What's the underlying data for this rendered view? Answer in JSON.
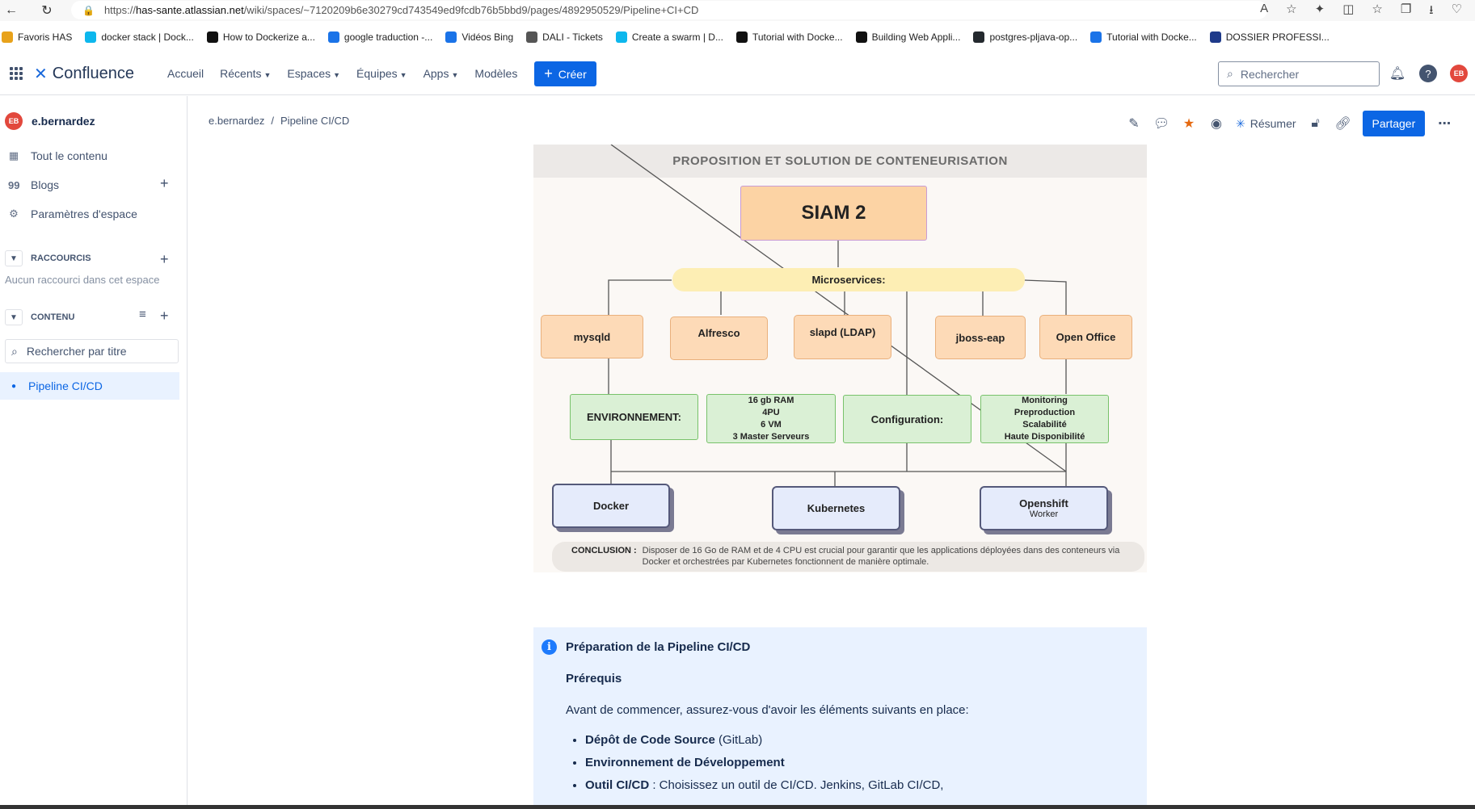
{
  "browser": {
    "url_prefix": "https://",
    "url_host": "has-sante.atlassian.net",
    "url_path": "/wiki/spaces/~7120209b6e30279cd743549ed9fcdb76b5bbd9/pages/4892950529/Pipeline+CI+CD",
    "bookmarks": [
      {
        "label": "Favoris HAS",
        "color": "#e8a21b"
      },
      {
        "label": "docker stack | Dock...",
        "color": "#0db7ed"
      },
      {
        "label": "How to Dockerize a...",
        "color": "#111111"
      },
      {
        "label": "google traduction -...",
        "color": "#1a73e8"
      },
      {
        "label": "Vidéos Bing",
        "color": "#1a73e8"
      },
      {
        "label": "DALI - Tickets",
        "color": "#555555"
      },
      {
        "label": "Create a swarm | D...",
        "color": "#0db7ed"
      },
      {
        "label": "Tutorial with Docke...",
        "color": "#111111"
      },
      {
        "label": "Building Web Appli...",
        "color": "#111111"
      },
      {
        "label": "postgres-pljava-op...",
        "color": "#24292e"
      },
      {
        "label": "Tutorial with Docke...",
        "color": "#1a73e8"
      },
      {
        "label": "DOSSIER PROFESSI...",
        "color": "#1e3a8a"
      }
    ]
  },
  "topnav": {
    "logo": "Confluence",
    "items": [
      "Accueil",
      "Récents",
      "Espaces",
      "Équipes",
      "Apps",
      "Modèles"
    ],
    "create_label": "Créer",
    "search_placeholder": "Rechercher",
    "avatar": "EB"
  },
  "sidebar": {
    "user_initials": "EB",
    "user_name": "e.bernardez",
    "items": [
      {
        "label": "Tout le contenu"
      },
      {
        "label": "Blogs"
      },
      {
        "label": "Paramètres d'espace"
      }
    ],
    "shortcuts_heading": "RACCOURCIS",
    "shortcuts_empty": "Aucun raccourci dans cet espace",
    "content_heading": "CONTENU",
    "filter_placeholder": "Rechercher par titre",
    "active_page": "Pipeline CI/CD"
  },
  "page": {
    "breadcrumb": [
      "e.bernardez",
      "Pipeline CI/CD"
    ],
    "summarize_label": "Résumer",
    "share_label": "Partager"
  },
  "diagram": {
    "title": "PROPOSITION ET SOLUTION DE CONTENEURISATION",
    "root": "SIAM 2",
    "microservices": "Microservices:",
    "services": [
      "mysqld",
      "Alfresco",
      "slapd (LDAP)",
      "jboss-eap",
      "Open Office"
    ],
    "environment_label": "ENVIRONNEMENT:",
    "resources": [
      "16 gb RAM",
      "4PU",
      "6 VM",
      "3 Master Serveurs"
    ],
    "configuration_label": "Configuration:",
    "features": [
      "Monitoring",
      "Preproduction",
      "Scalabilité",
      "Haute Disponibilité"
    ],
    "platforms": [
      {
        "name": "Docker",
        "sub": ""
      },
      {
        "name": "Kubernetes",
        "sub": ""
      },
      {
        "name": "Openshift",
        "sub": "Worker"
      }
    ],
    "conclusion_label": "CONCLUSION :",
    "conclusion_text": "Disposer de 16 Go de RAM et de 4 CPU est crucial pour garantir que les applications déployées dans des conteneurs via Docker et orchestrées par Kubernetes fonctionnent de manière optimale."
  },
  "info_panel": {
    "title": "Préparation de la Pipeline CI/CD",
    "subtitle": "Prérequis",
    "intro": "Avant de commencer, assurez-vous d'avoir les éléments suivants en place:",
    "items": [
      {
        "bold": "Dépôt de Code Source",
        "rest": " (GitLab)"
      },
      {
        "bold": "Environnement de Développement",
        "rest": ""
      },
      {
        "bold": "Outil CI/CD",
        "rest": " : Choisissez un outil de CI/CD. Jenkins, GitLab CI/CD,"
      }
    ]
  }
}
